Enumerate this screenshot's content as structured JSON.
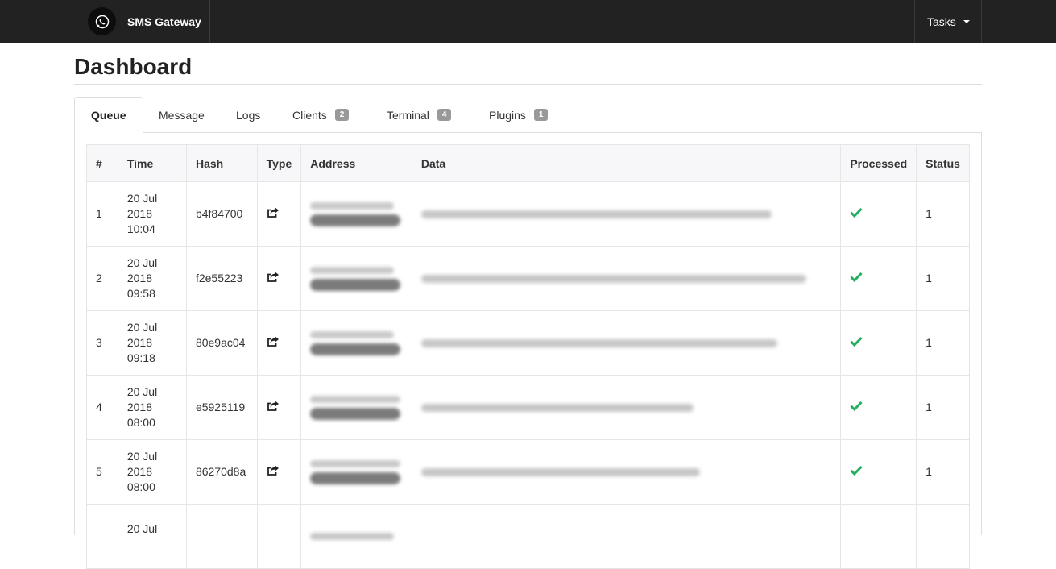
{
  "navbar": {
    "brand_name": "SMS Gateway",
    "logo_icon": "whatsapp-icon",
    "menu_label": "Tasks"
  },
  "page": {
    "title": "Dashboard"
  },
  "tabs": [
    {
      "label": "Queue",
      "active": true
    },
    {
      "label": "Message"
    },
    {
      "label": "Logs"
    },
    {
      "label": "Clients",
      "badge": "2"
    },
    {
      "label": "Terminal",
      "badge": "4"
    },
    {
      "label": "Plugins",
      "badge": "1"
    }
  ],
  "table": {
    "headers": [
      "#",
      "Time",
      "Hash",
      "Type",
      "Address",
      "Data",
      "Processed",
      "Status"
    ],
    "rows": [
      {
        "num": "1",
        "time": [
          "20 Jul",
          "2018",
          "10:04"
        ],
        "hash": "b4f84700",
        "type_icon": "share-icon",
        "processed_icon": "check-icon",
        "status": "1"
      },
      {
        "num": "2",
        "time": [
          "20 Jul",
          "2018",
          "09:58"
        ],
        "hash": "f2e55223",
        "type_icon": "share-icon",
        "processed_icon": "check-icon",
        "status": "1"
      },
      {
        "num": "3",
        "time": [
          "20 Jul",
          "2018",
          "09:18"
        ],
        "hash": "80e9ac04",
        "type_icon": "share-icon",
        "processed_icon": "check-icon",
        "status": "1"
      },
      {
        "num": "4",
        "time": [
          "20 Jul",
          "2018",
          "08:00"
        ],
        "hash": "e5925119",
        "type_icon": "share-icon",
        "processed_icon": "check-icon",
        "status": "1"
      },
      {
        "num": "5",
        "time": [
          "20 Jul",
          "2018",
          "08:00"
        ],
        "hash": "86270d8a",
        "type_icon": "share-icon",
        "processed_icon": "check-icon",
        "status": "1"
      },
      {
        "num": "",
        "time": [
          "20 Jul",
          "",
          ""
        ],
        "hash": "",
        "type_icon": "",
        "processed_icon": "",
        "status": ""
      }
    ]
  },
  "colors": {
    "navbar_bg": "#222222",
    "check_green": "#27ae60",
    "badge_bg": "#999999"
  }
}
